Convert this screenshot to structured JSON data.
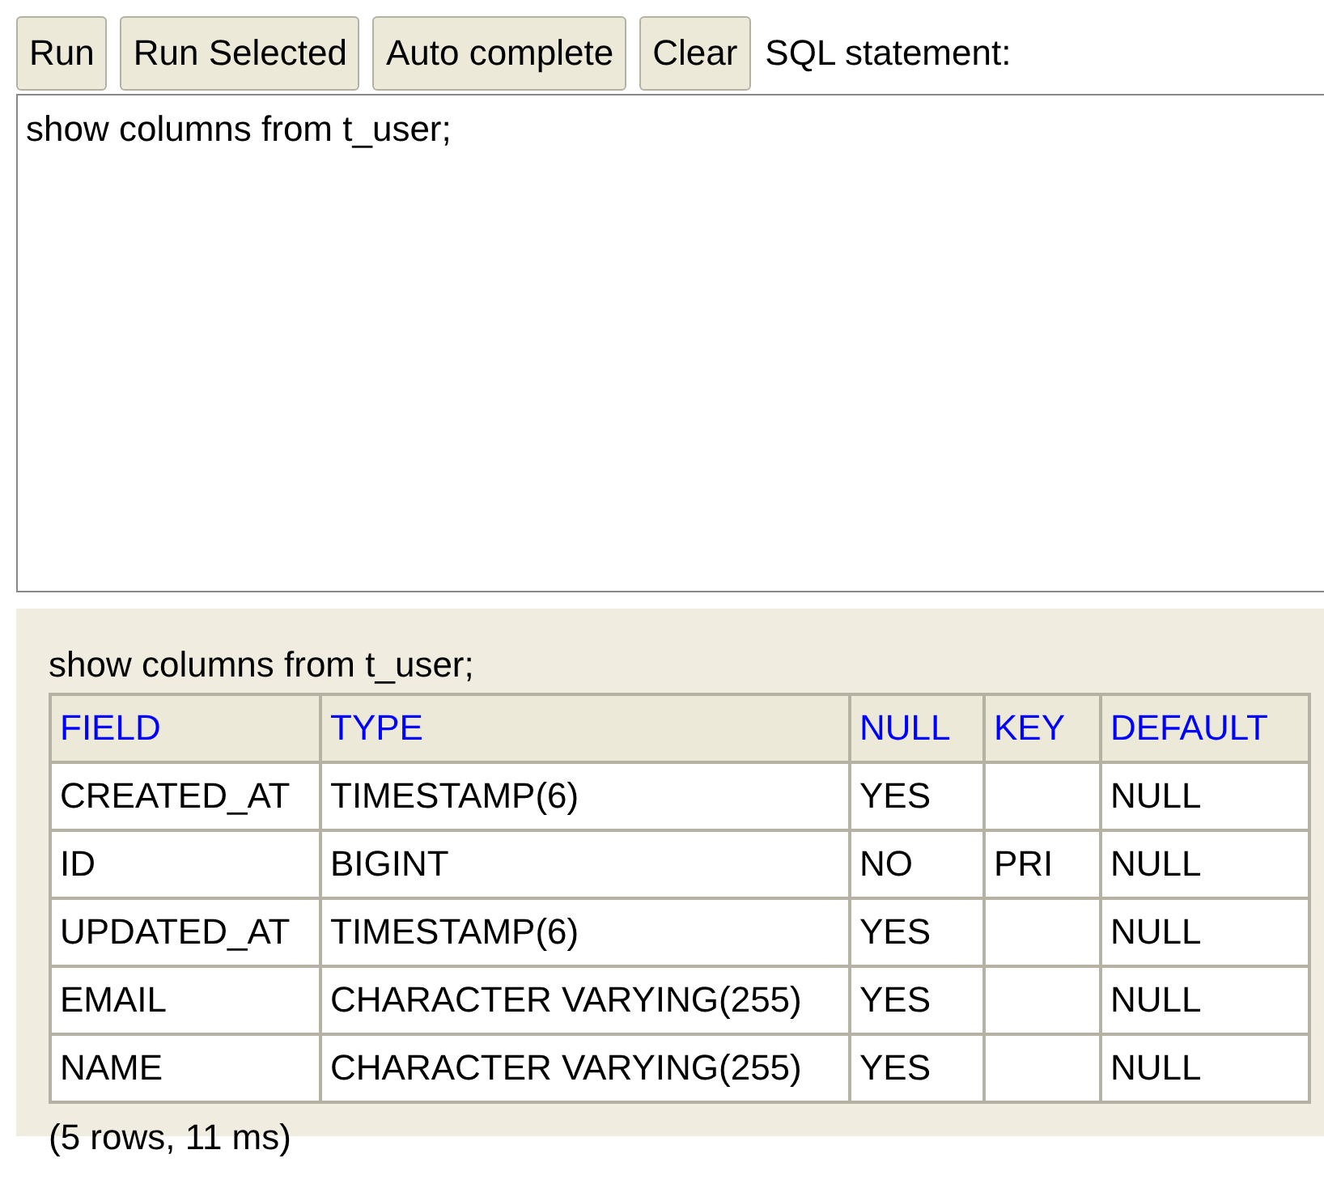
{
  "toolbar": {
    "buttons": [
      "Run",
      "Run Selected",
      "Auto complete",
      "Clear"
    ],
    "label": "SQL statement:"
  },
  "editor": {
    "value": "show columns from t_user;"
  },
  "result": {
    "statement": "show columns from t_user;",
    "columns": [
      "FIELD",
      "TYPE",
      "NULL",
      "KEY",
      "DEFAULT"
    ],
    "rows": [
      [
        "CREATED_AT",
        "TIMESTAMP(6)",
        "YES",
        "",
        "NULL"
      ],
      [
        "ID",
        "BIGINT",
        "NO",
        "PRI",
        "NULL"
      ],
      [
        "UPDATED_AT",
        "TIMESTAMP(6)",
        "YES",
        "",
        "NULL"
      ],
      [
        "EMAIL",
        "CHARACTER VARYING(255)",
        "YES",
        "",
        "NULL"
      ],
      [
        "NAME",
        "CHARACTER VARYING(255)",
        "YES",
        "",
        "NULL"
      ]
    ],
    "summary": "(5 rows, 11 ms)"
  }
}
